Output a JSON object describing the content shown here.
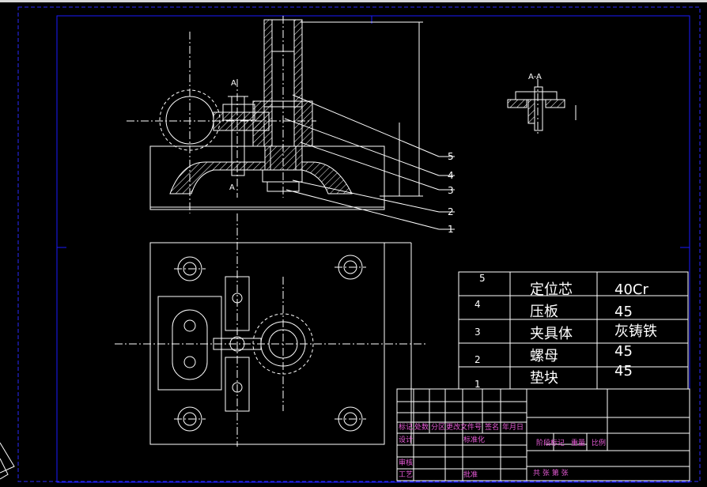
{
  "section_label": "A-A",
  "cut_label_top": "A",
  "cut_label_bottom": "A",
  "leaders": [
    "5",
    "4",
    "3",
    "2",
    "1"
  ],
  "bom": [
    {
      "no": "5",
      "name": "定位芯",
      "material": "40Cr"
    },
    {
      "no": "4",
      "name": "压板",
      "material": "45"
    },
    {
      "no": "3",
      "name": "夹具体",
      "material": "灰铸铁"
    },
    {
      "no": "2",
      "name": "螺母",
      "material": "45"
    },
    {
      "no": "1",
      "name": "垫块",
      "material": "45"
    }
  ],
  "title_block": {
    "row1": [
      "标记",
      "处数",
      "分区",
      "更改文件号",
      "签名",
      "年月日"
    ],
    "row2": [
      "设计",
      "标准化"
    ],
    "right_labels": [
      "阶段标记",
      "重量",
      "比例"
    ],
    "row_review": "审核",
    "row_process": "工艺",
    "row_approve": "批准",
    "sheet_info": "共  张 第  张"
  },
  "colors": {
    "background": "#000000",
    "lines": "#ffffff",
    "frame": "#1a1aff",
    "title_text": "#e85bd8"
  }
}
